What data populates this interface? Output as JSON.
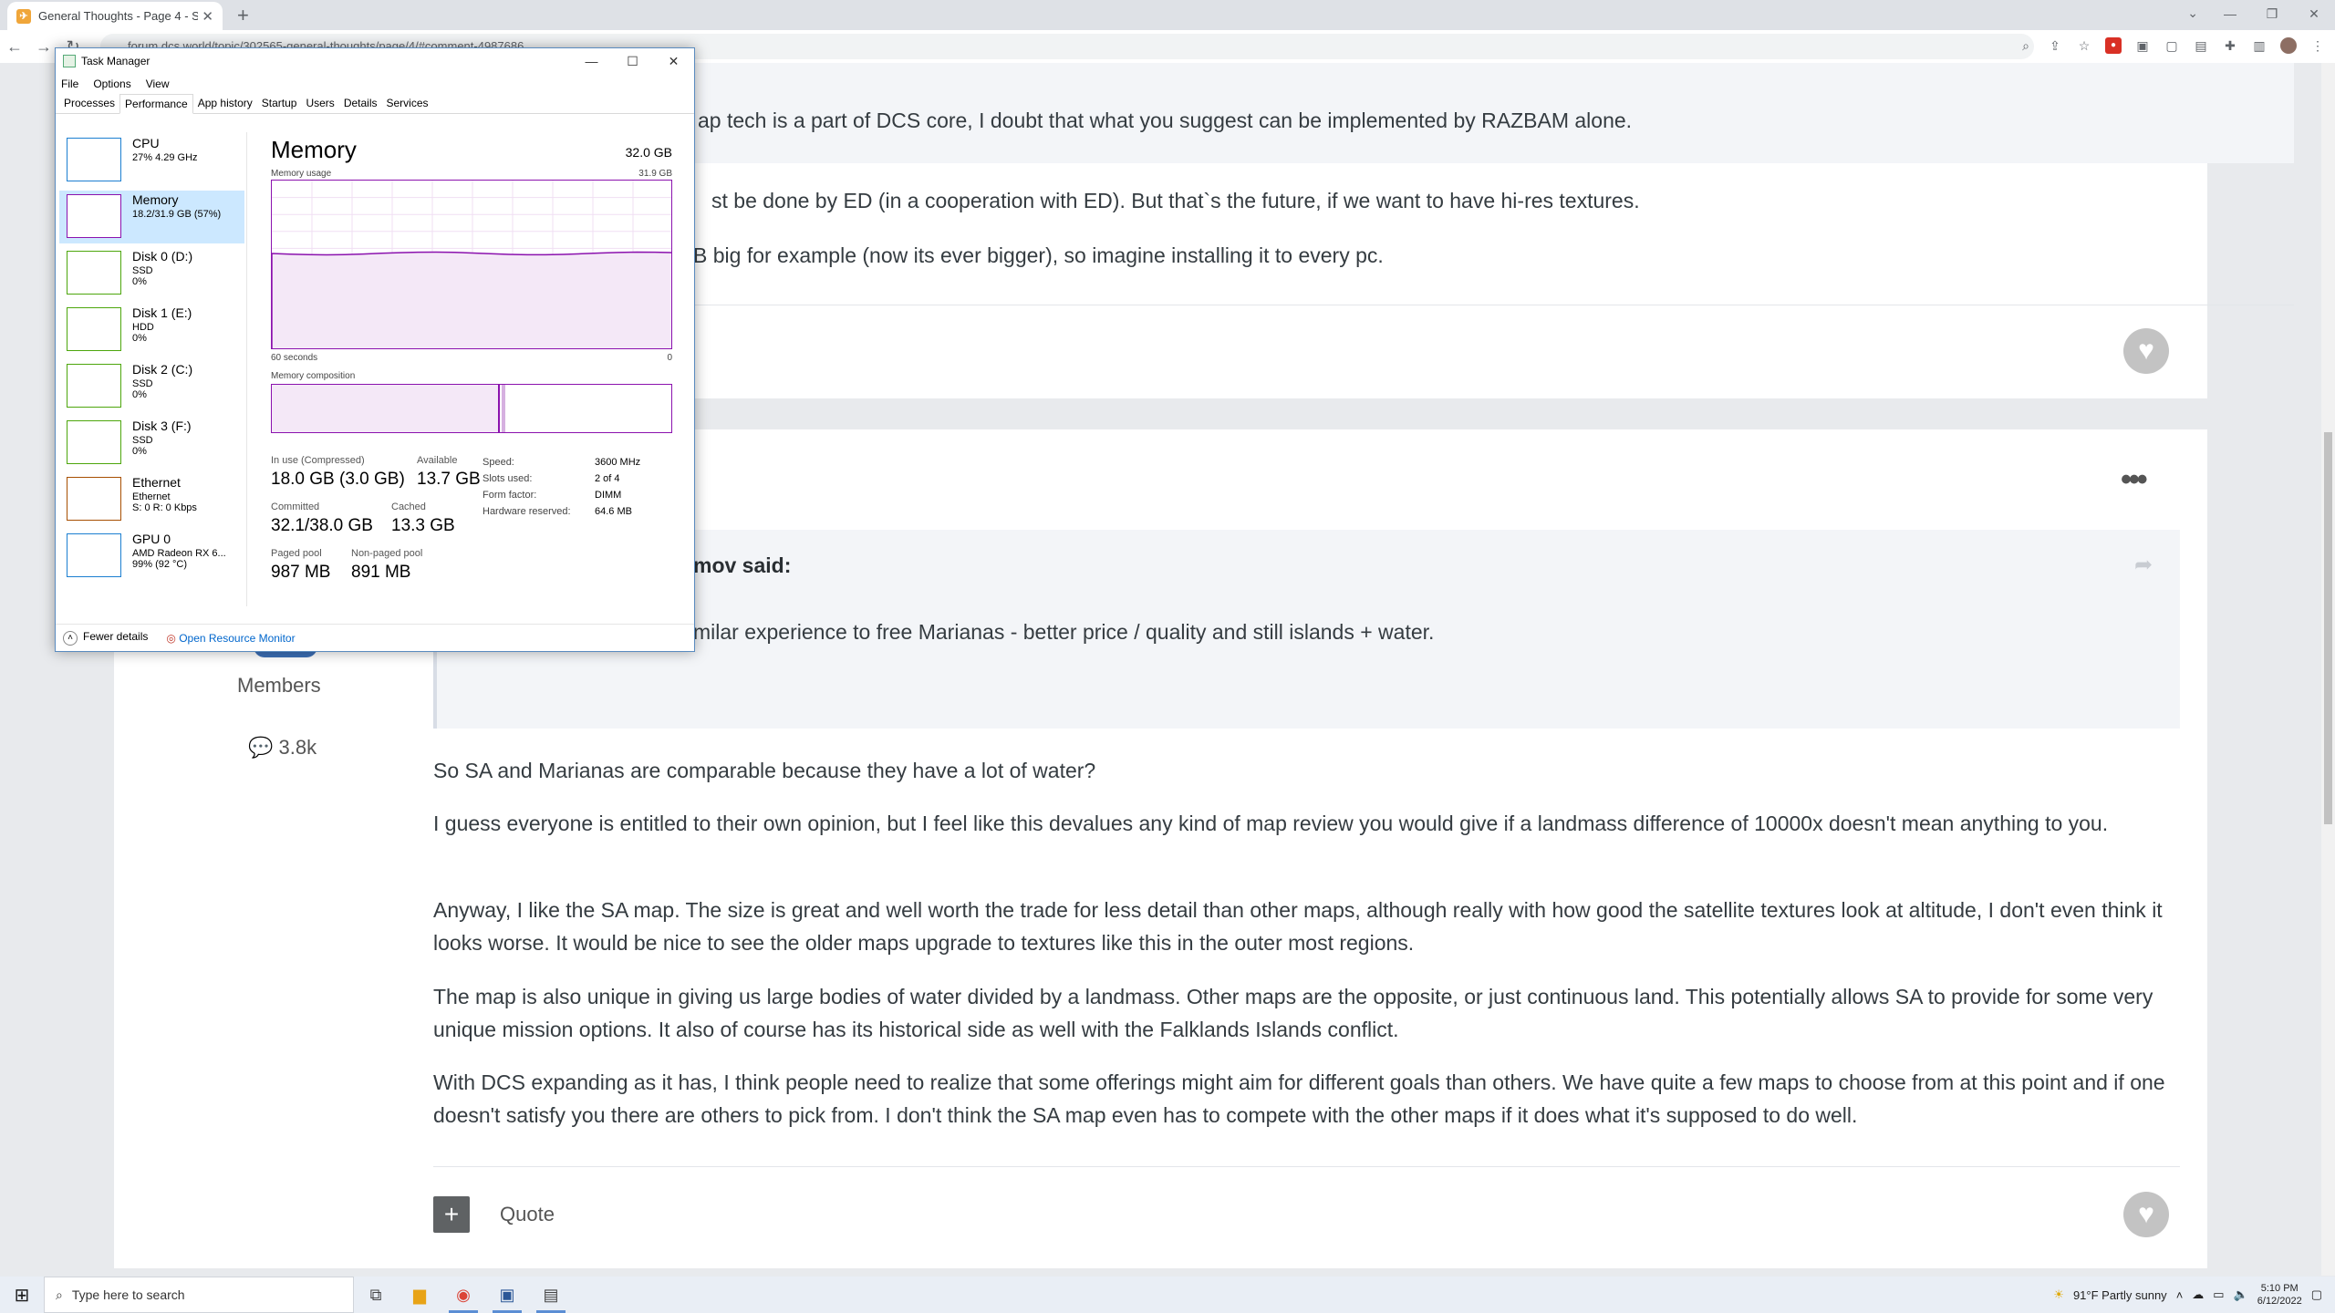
{
  "browser": {
    "tab_title": "General Thoughts - Page 4 - So...",
    "url": "forum.dcs.world/topic/302565-general-thoughts/page/4/#comment-4987686",
    "new_tab": "+"
  },
  "post1": {
    "quote_line": "ap tech is a part of DCS core, I doubt that what you suggest can be implemented by RAZBAM alone.",
    "line1": "st be done by ED (in a cooperation with ED). But that`s the future, if we want to have hi-res textures.",
    "line2": "B big for example (now its ever bigger), so imagine installing it to every pc."
  },
  "post2": {
    "author_role": "Members",
    "post_count": "3.8k",
    "quote_author": "mov said:",
    "quote_text": "milar experience to free Marianas - better price / quality and still islands + water.",
    "paragraphs": [
      "So SA and Marianas are comparable because they have a lot of water?",
      "I guess everyone is entitled to their own opinion, but I feel like this devalues any kind of map review you would give if a landmass difference of 10000x doesn't mean anything to you.",
      "Anyway, I like the SA map. The size is great and well worth the trade for less detail than other maps, although really with how good the satellite textures look at altitude, I don't even think it looks worse. It would be nice to see the older maps upgrade to textures like this in the outer most regions.",
      "The map is also unique in giving us large bodies of water divided by a landmass. Other maps are the opposite, or just continuous land. This potentially allows SA to provide for some very unique mission options. It also of course has its historical side as well with the Falklands Islands conflict.",
      "With DCS expanding as it has, I think people need to realize that some offerings might aim for different goals than others. We have quite a few maps to choose from at this point and if one doesn't satisfy you there are others to pick from. I don't think the SA map even has to compete with the other maps if it does what it's supposed to do well."
    ],
    "quote_button": "Quote"
  },
  "taskmanager": {
    "title": "Task Manager",
    "menu": [
      "File",
      "Options",
      "View"
    ],
    "tabs": [
      "Processes",
      "Performance",
      "App history",
      "Startup",
      "Users",
      "Details",
      "Services"
    ],
    "resources": [
      {
        "name": "CPU",
        "sub1": "27%  4.29 GHz",
        "sub2": "",
        "color": "#1c7fd1"
      },
      {
        "name": "Memory",
        "sub1": "18.2/31.9 GB (57%)",
        "sub2": "",
        "color": "#8b12ae"
      },
      {
        "name": "Disk 0 (D:)",
        "sub1": "SSD",
        "sub2": "0%",
        "color": "#4da60c"
      },
      {
        "name": "Disk 1 (E:)",
        "sub1": "HDD",
        "sub2": "0%",
        "color": "#4da60c"
      },
      {
        "name": "Disk 2 (C:)",
        "sub1": "SSD",
        "sub2": "0%",
        "color": "#4da60c"
      },
      {
        "name": "Disk 3 (F:)",
        "sub1": "SSD",
        "sub2": "0%",
        "color": "#4da60c"
      },
      {
        "name": "Ethernet",
        "sub1": "Ethernet",
        "sub2": "S: 0 R: 0 Kbps",
        "color": "#a74f01"
      },
      {
        "name": "GPU 0",
        "sub1": "AMD Radeon RX 6...",
        "sub2": "99% (92 °C)",
        "color": "#1c7fd1"
      }
    ],
    "memory": {
      "heading": "Memory",
      "total": "32.0 GB",
      "usage_label": "Memory usage",
      "usage_max": "31.9 GB",
      "time_left": "60 seconds",
      "time_right": "0",
      "composition_label": "Memory composition",
      "in_use_label": "In use (Compressed)",
      "in_use_value": "18.0 GB (3.0 GB)",
      "available_label": "Available",
      "available_value": "13.7 GB",
      "committed_label": "Committed",
      "committed_value": "32.1/38.0 GB",
      "cached_label": "Cached",
      "cached_value": "13.3 GB",
      "paged_label": "Paged pool",
      "paged_value": "987 MB",
      "nonpaged_label": "Non-paged pool",
      "nonpaged_value": "891 MB",
      "details": [
        {
          "k": "Speed:",
          "v": "3600 MHz"
        },
        {
          "k": "Slots used:",
          "v": "2 of 4"
        },
        {
          "k": "Form factor:",
          "v": "DIMM"
        },
        {
          "k": "Hardware reserved:",
          "v": "64.6 MB"
        }
      ],
      "usage_fraction": 0.57
    },
    "footer": {
      "fewer": "Fewer details",
      "monitor": "Open Resource Monitor"
    }
  },
  "taskbar": {
    "search_placeholder": "Type here to search",
    "weather": "91°F  Partly sunny",
    "time": "5:10 PM",
    "date": "6/12/2022"
  }
}
